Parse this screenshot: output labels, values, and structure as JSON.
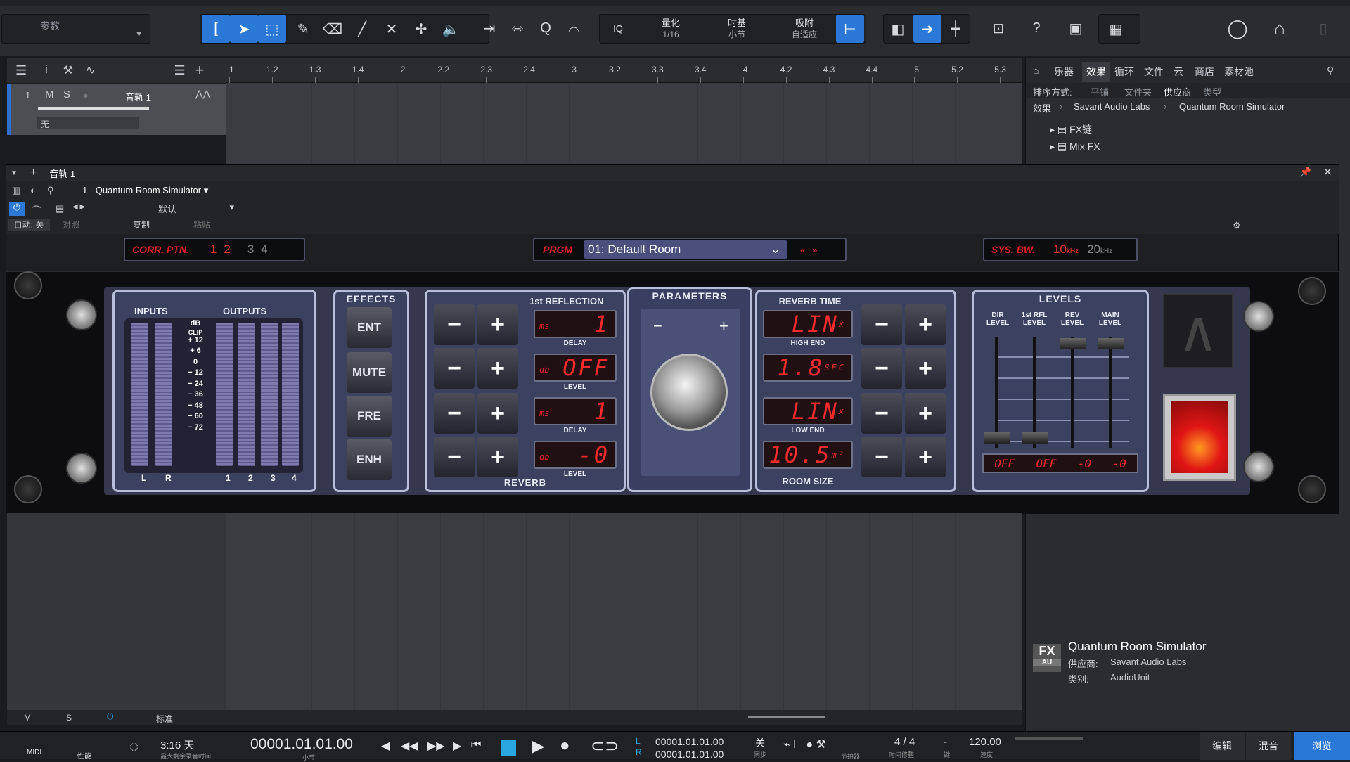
{
  "top": {
    "params_label": "参数",
    "quantize_label": "量化",
    "quantize_value": "1/16",
    "timebase_label": "时基",
    "timebase_value": "小节",
    "snap_label": "吸附",
    "snap_value": "自适应",
    "iq": "IQ",
    "help": "?"
  },
  "ruler": {
    "ticks": [
      "1",
      "1.2",
      "1.3",
      "1.4",
      "2",
      "2.2",
      "2.3",
      "2.4",
      "3",
      "3.2",
      "3.3",
      "3.4",
      "4",
      "4.2",
      "4.3",
      "4.4",
      "5",
      "5.2",
      "5.3"
    ]
  },
  "track": {
    "number": "1",
    "m": "M",
    "s": "S",
    "name": "音轨 1",
    "input": "无"
  },
  "browser": {
    "tabs": [
      "乐器",
      "效果",
      "循环",
      "文件",
      "云",
      "商店",
      "素材池"
    ],
    "sort_label": "排序方式:",
    "sort_opts": [
      "平铺",
      "文件夹",
      "供应商",
      "类型"
    ],
    "crumb": [
      "效果",
      "Savant Audio Labs",
      "Quantum Room Simulator"
    ],
    "items": [
      "FX链",
      "Mix FX"
    ],
    "info_title": "Quantum Room Simulator",
    "info_vendor_label": "供应商:",
    "info_vendor": "Savant Audio Labs",
    "info_cat_label": "类别:",
    "info_cat": "AudioUnit",
    "fx_badge": "FX",
    "au_badge": "AU"
  },
  "plugin": {
    "window_title": "音轨 1",
    "instance": "1 - Quantum Room Simulator",
    "preset": "默认",
    "auto": "自动: 关",
    "compare": "对照",
    "copy": "复制",
    "paste": "粘贴",
    "corr_label": "CORR. PTN.",
    "corr_opts": [
      "1",
      "2",
      "3",
      "4"
    ],
    "prgm_label": "PRGM",
    "prgm_value": "01: Default Room",
    "sysbw_label": "SYS. BW.",
    "bw10": "10",
    "bw20": "20",
    "khz": "kHz",
    "inputs": "INPUTS",
    "outputs": "OUTPUTS",
    "db": "dB",
    "clip": "CLIP",
    "scale": [
      "+ 12",
      "+ 6",
      "0",
      "− 12",
      "− 24",
      "− 36",
      "− 48",
      "− 60",
      "− 72"
    ],
    "chan": [
      "L",
      "R",
      "1",
      "2",
      "3",
      "4"
    ],
    "effects_title": "EFFECTS",
    "effects": [
      "ENT",
      "MUTE",
      "FRE",
      "ENH"
    ],
    "refl_title": "1st REFLECTION",
    "refl_delay": "1",
    "refl_level": "OFF",
    "rev_delay": "1",
    "rev_level": "-0",
    "delay": "DELAY",
    "level": "LEVEL",
    "reverb": "REVERB",
    "ms": "ms",
    "dbu": "db",
    "param_title": "PARAMETERS",
    "minus": "−",
    "plus": "+",
    "rt_title": "REVERB TIME",
    "high_end_val": "LIN",
    "high_end": "HIGH END",
    "rt_val": "1.8",
    "sec": "SEC",
    "low_end_val": "LIN",
    "low_end": "LOW END",
    "room_val": "10.5",
    "m3": "m³",
    "room_size": "ROOM SIZE",
    "x": "x",
    "levels_title": "LEVELS",
    "lv_labels": [
      "DIR LEVEL",
      "1st RFL LEVEL",
      "REV LEVEL",
      "MAIN LEVEL"
    ],
    "lv_vals": [
      "OFF",
      "OFF",
      "-0",
      "-0"
    ]
  },
  "bottom": {
    "m": "M",
    "s": "S",
    "standard": "标准",
    "midi": "MIDI",
    "perf": "性能",
    "time_remain": "3:16 天",
    "time_sub": "最大剩余录音时间",
    "position": "00001.01.01.00",
    "pos_sub": "小节",
    "L_pos": "00001.01.01.00",
    "R_pos": "00001.01.01.00",
    "L": "L",
    "R": "R",
    "sync": "关",
    "sync_sub": "同步",
    "meter": "4 / 4",
    "meter_sub": "时间修整",
    "key": "-",
    "key_sub": "键",
    "tempo": "120.00",
    "tempo_sub": "速度",
    "metronome": "节拍器",
    "edit": "编辑",
    "mix": "混音",
    "browse": "浏览"
  }
}
